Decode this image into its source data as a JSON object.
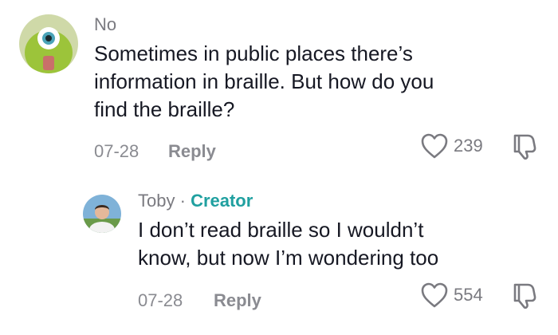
{
  "comments": [
    {
      "username": "No",
      "text": "Sometimes in public places there’s\ninformation in braille. But how do you\nfind the braille?",
      "date": "07-28",
      "reply_label": "Reply",
      "likes": "239"
    }
  ],
  "reply": {
    "username": "Toby",
    "separator": "·",
    "badge": "Creator",
    "text": "I don’t read braille so I wouldn’t\nknow, but now I’m wondering too",
    "date": "07-28",
    "reply_label": "Reply",
    "likes": "554"
  },
  "icons": {
    "like": "heart-outline-icon",
    "dislike": "thumbs-down-outline-icon"
  },
  "colors": {
    "creator_badge": "#20a0a0",
    "text": "#161823",
    "muted": "#8a8b91"
  }
}
